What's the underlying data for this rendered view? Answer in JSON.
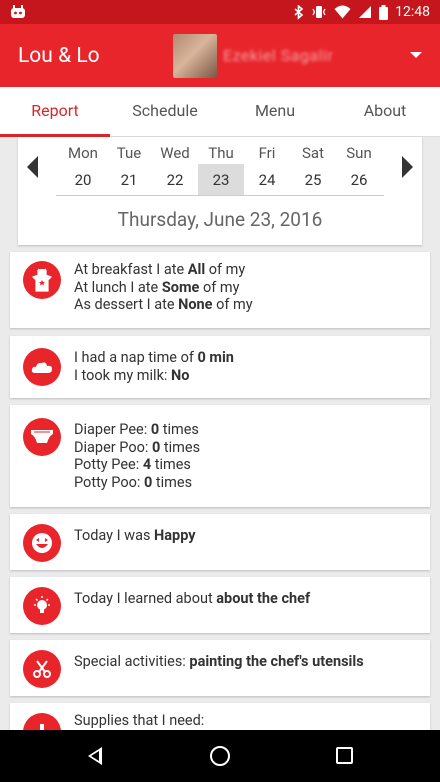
{
  "status_bar": {
    "time": "12:48"
  },
  "app_bar": {
    "title": "Lou & Lo",
    "account_name": "Ezekiel Sagalir"
  },
  "tabs": [
    {
      "label": "Report"
    },
    {
      "label": "Schedule"
    },
    {
      "label": "Menu"
    },
    {
      "label": "About"
    }
  ],
  "calendar": {
    "days": [
      {
        "name": "Mon",
        "date": "20"
      },
      {
        "name": "Tue",
        "date": "21"
      },
      {
        "name": "Wed",
        "date": "22"
      },
      {
        "name": "Thu",
        "date": "23"
      },
      {
        "name": "Fri",
        "date": "24"
      },
      {
        "name": "Sat",
        "date": "25"
      },
      {
        "name": "Sun",
        "date": "26"
      }
    ],
    "selected_date": "Thursday, June 23, 2016"
  },
  "report": {
    "meals": {
      "breakfast_prefix": "At breakfast I ate ",
      "breakfast_value": "All",
      "breakfast_suffix": " of my",
      "lunch_prefix": "At lunch I ate ",
      "lunch_value": "Some",
      "lunch_suffix": " of my",
      "dessert_prefix": "As dessert I ate ",
      "dessert_value": "None",
      "dessert_suffix": " of my"
    },
    "nap": {
      "nap_prefix": "I had a nap time of ",
      "nap_value": "0 min",
      "milk_prefix": "I took my milk: ",
      "milk_value": "No"
    },
    "diaper": {
      "pee_prefix": "Diaper Pee: ",
      "pee_value": "0",
      "pee_suffix": " times",
      "poo_prefix": "Diaper Poo: ",
      "poo_value": "0",
      "poo_suffix": " times",
      "potty_pee_prefix": "Potty Pee: ",
      "potty_pee_value": "4",
      "potty_pee_suffix": " times",
      "potty_poo_prefix": "Potty Poo: ",
      "potty_poo_value": "0",
      "potty_poo_suffix": " times"
    },
    "mood": {
      "prefix": "Today I was ",
      "value": "Happy"
    },
    "learned": {
      "prefix": "Today I learned about ",
      "value": "about the chef"
    },
    "activities": {
      "prefix": "Special activities: ",
      "value": "painting the chef's utensils"
    },
    "supplies": {
      "prefix": "Supplies that I need:"
    }
  },
  "colors": {
    "primary": "#e8252b",
    "status_bar": "#c4161c",
    "accent": "#d7262b"
  }
}
